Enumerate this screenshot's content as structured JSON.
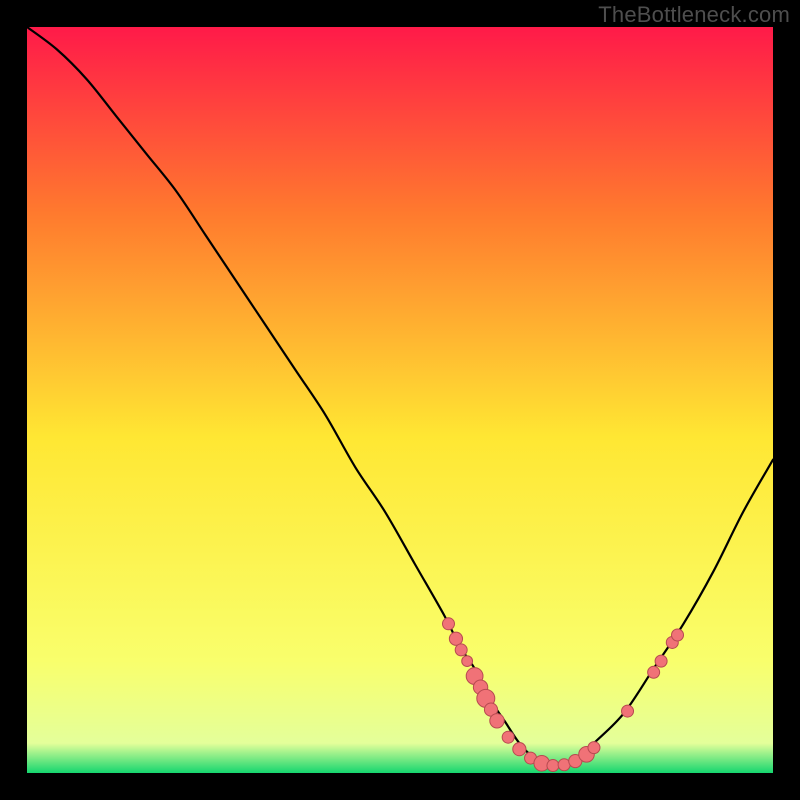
{
  "watermark": "TheBottleneck.com",
  "colors": {
    "background": "#000000",
    "watermark_text": "#4e4e4e",
    "gradient_top": "#ff1a49",
    "gradient_mid1": "#ff7a2e",
    "gradient_mid2": "#ffe733",
    "gradient_low": "#f9ff6c",
    "gradient_bottom": "#15d66f",
    "curve": "#000000",
    "marker_fill": "#f07277",
    "marker_stroke": "#b74a50"
  },
  "chart_data": {
    "type": "line",
    "title": "",
    "xlabel": "",
    "ylabel": "",
    "xlim": [
      0,
      100
    ],
    "ylim": [
      0,
      100
    ],
    "grid": false,
    "series": [
      {
        "name": "bottleneck-curve",
        "x": [
          0,
          4,
          8,
          12,
          16,
          20,
          24,
          28,
          32,
          36,
          40,
          44,
          48,
          52,
          56,
          58,
          60,
          62,
          64,
          66,
          68,
          70,
          72,
          74,
          76,
          80,
          84,
          88,
          92,
          96,
          100
        ],
        "y": [
          100,
          97,
          93,
          88,
          83,
          78,
          72,
          66,
          60,
          54,
          48,
          41,
          35,
          28,
          21,
          17,
          14,
          10,
          7,
          4,
          2,
          1,
          1,
          2,
          4,
          8,
          14,
          20,
          27,
          35,
          42
        ]
      }
    ],
    "markers": [
      {
        "x": 56.5,
        "y": 20,
        "r": 1.0
      },
      {
        "x": 57.5,
        "y": 18,
        "r": 1.1
      },
      {
        "x": 58.2,
        "y": 16.5,
        "r": 1.0
      },
      {
        "x": 59.0,
        "y": 15,
        "r": 0.9
      },
      {
        "x": 60.0,
        "y": 13,
        "r": 1.4
      },
      {
        "x": 60.8,
        "y": 11.5,
        "r": 1.2
      },
      {
        "x": 61.5,
        "y": 10.0,
        "r": 1.5
      },
      {
        "x": 62.2,
        "y": 8.5,
        "r": 1.1
      },
      {
        "x": 63.0,
        "y": 7,
        "r": 1.2
      },
      {
        "x": 64.5,
        "y": 4.8,
        "r": 1.0
      },
      {
        "x": 66.0,
        "y": 3.2,
        "r": 1.1
      },
      {
        "x": 67.5,
        "y": 2.0,
        "r": 1.0
      },
      {
        "x": 69.0,
        "y": 1.3,
        "r": 1.3
      },
      {
        "x": 70.5,
        "y": 1.0,
        "r": 1.0
      },
      {
        "x": 72.0,
        "y": 1.1,
        "r": 1.0
      },
      {
        "x": 73.5,
        "y": 1.6,
        "r": 1.1
      },
      {
        "x": 75.0,
        "y": 2.5,
        "r": 1.3
      },
      {
        "x": 76.0,
        "y": 3.4,
        "r": 1.0
      },
      {
        "x": 80.5,
        "y": 8.3,
        "r": 1.0
      },
      {
        "x": 84.0,
        "y": 13.5,
        "r": 1.0
      },
      {
        "x": 85.0,
        "y": 15.0,
        "r": 1.0
      },
      {
        "x": 86.5,
        "y": 17.5,
        "r": 1.0
      },
      {
        "x": 87.2,
        "y": 18.5,
        "r": 1.0
      }
    ]
  }
}
